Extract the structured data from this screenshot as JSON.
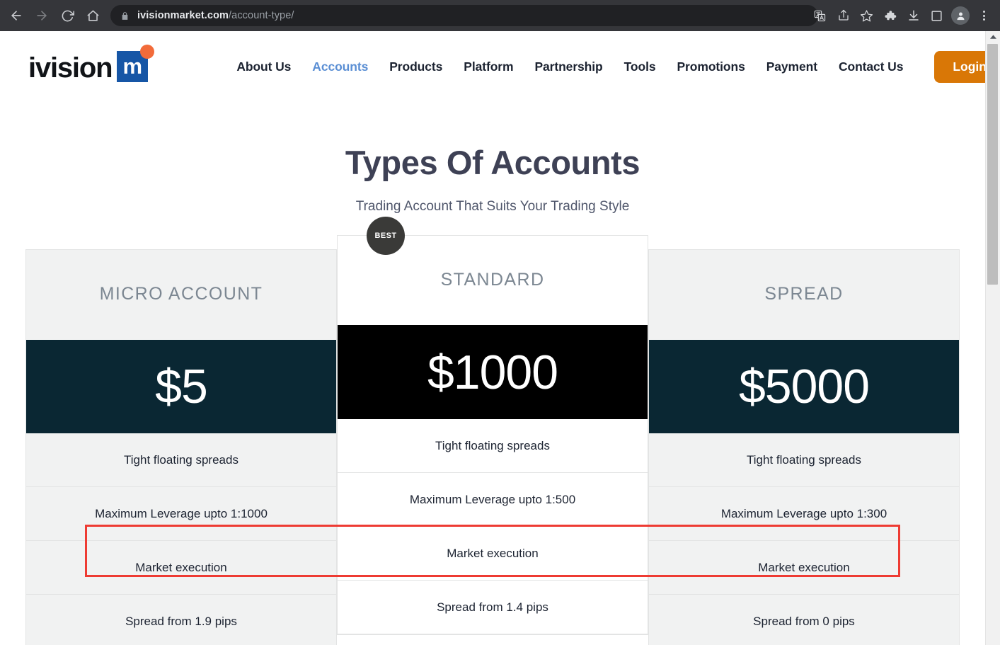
{
  "browser": {
    "back_icon": "back-arrow-icon",
    "forward_icon": "forward-arrow-icon",
    "reload_icon": "reload-icon",
    "home_icon": "home-icon",
    "lock_icon": "lock-icon",
    "url_domain": "ivisionmarket.com",
    "url_path": "/account-type/",
    "toolbar_icons": [
      "translate-icon",
      "share-icon",
      "bookmark-star-icon",
      "extensions-puzzle-icon",
      "downloads-icon",
      "sidebar-panel-icon",
      "profile-avatar-icon",
      "chrome-menu-icon"
    ]
  },
  "site": {
    "logo": {
      "word": "ivision",
      "badge_letter": "m",
      "badge_color": "#1656A6",
      "dot_color": "#F26B3A"
    },
    "nav": [
      {
        "label": "About Us",
        "active": false
      },
      {
        "label": "Accounts",
        "active": true
      },
      {
        "label": "Products",
        "active": false
      },
      {
        "label": "Platform",
        "active": false
      },
      {
        "label": "Partnership",
        "active": false
      },
      {
        "label": "Tools",
        "active": false
      },
      {
        "label": "Promotions",
        "active": false
      },
      {
        "label": "Payment",
        "active": false
      },
      {
        "label": "Contact Us",
        "active": false
      }
    ],
    "login_label": "Login",
    "login_color": "#D97706",
    "active_nav_color": "#5B8FD4"
  },
  "hero": {
    "title": "Types Of Accounts",
    "subtitle": "Trading Account That Suits Your Trading Style"
  },
  "pricing": {
    "best_badge": "BEST",
    "cards": [
      {
        "title": "MICRO ACCOUNT",
        "price": "$5",
        "price_bg": "#0A2733",
        "featured": false,
        "features": [
          "Tight floating spreads",
          "Maximum Leverage upto 1:1000",
          "Market execution",
          "Spread from 1.9 pips"
        ]
      },
      {
        "title": "STANDARD",
        "price": "$1000",
        "price_bg": "#000000",
        "featured": true,
        "features": [
          "Tight floating spreads",
          "Maximum Leverage upto 1:500",
          "Market execution",
          "Spread from 1.4 pips"
        ]
      },
      {
        "title": "SPREAD",
        "price": "$5000",
        "price_bg": "#0A2733",
        "featured": false,
        "features": [
          "Tight floating spreads",
          "Maximum Leverage upto 1:300",
          "Market execution",
          "Spread from 0 pips"
        ]
      }
    ]
  },
  "annotation": {
    "highlight_color": "#EE3B33",
    "highlight_target": "Maximum Leverage row"
  }
}
